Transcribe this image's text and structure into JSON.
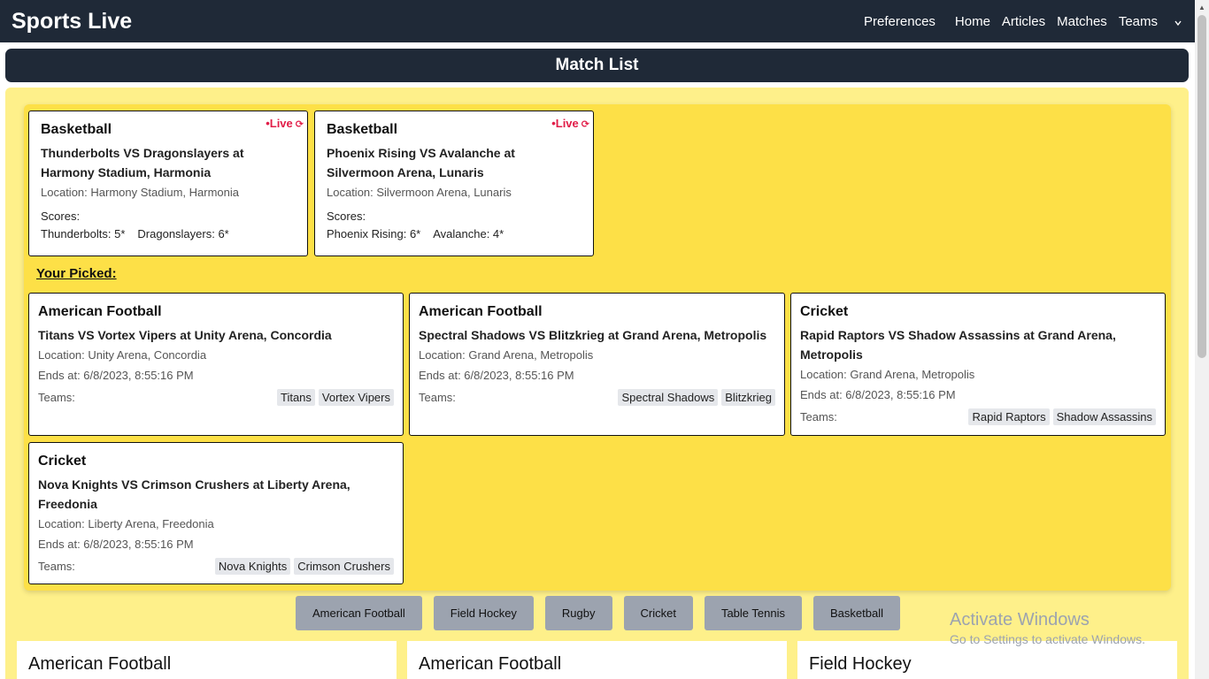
{
  "navbar": {
    "brand": "Sports Live",
    "preferences": "Preferences",
    "links": [
      "Home",
      "Articles",
      "Matches",
      "Teams"
    ],
    "dropdown_icon": "chevron-down-icon"
  },
  "page_title": "Match List",
  "live_matches": [
    {
      "sport": "Basketball",
      "title": "Thunderbolts VS Dragonslayers at Harmony Stadium, Harmonia",
      "location": "Location: Harmony Stadium, Harmonia",
      "live_label": "•Live",
      "scores_label": "Scores:",
      "score1": "Thunderbolts: 5*",
      "score2": "Dragonslayers: 6*"
    },
    {
      "sport": "Basketball",
      "title": "Phoenix Rising VS Avalanche at Silvermoon Arena, Lunaris",
      "location": "Location: Silvermoon Arena, Lunaris",
      "live_label": "•Live",
      "scores_label": "Scores:",
      "score1": "Phoenix Rising: 6*",
      "score2": "Avalanche: 4*"
    }
  ],
  "picked_label": "Your Picked:",
  "picked_matches": [
    {
      "sport": "American Football",
      "title": "Titans VS Vortex Vipers at Unity Arena, Concordia",
      "location": "Location: Unity Arena, Concordia",
      "ends": "Ends at: 6/8/2023, 8:55:16 PM",
      "teams_label": "Teams:",
      "team1": "Titans",
      "team2": "Vortex Vipers"
    },
    {
      "sport": "American Football",
      "title": "Spectral Shadows VS Blitzkrieg at Grand Arena, Metropolis",
      "location": "Location: Grand Arena, Metropolis",
      "ends": "Ends at: 6/8/2023, 8:55:16 PM",
      "teams_label": "Teams:",
      "team1": "Spectral Shadows",
      "team2": "Blitzkrieg"
    },
    {
      "sport": "Cricket",
      "title": "Rapid Raptors VS Shadow Assassins at Grand Arena, Metropolis",
      "location": "Location: Grand Arena, Metropolis",
      "ends": "Ends at: 6/8/2023, 8:55:16 PM",
      "teams_label": "Teams:",
      "team1": "Rapid Raptors",
      "team2": "Shadow Assassins"
    },
    {
      "sport": "Cricket",
      "title": "Nova Knights VS Crimson Crushers at Liberty Arena, Freedonia",
      "location": "Location: Liberty Arena, Freedonia",
      "ends": "Ends at: 6/8/2023, 8:55:16 PM",
      "teams_label": "Teams:",
      "team1": "Nova Knights",
      "team2": "Crimson Crushers"
    }
  ],
  "filters": [
    "American Football",
    "Field Hockey",
    "Rugby",
    "Cricket",
    "Table Tennis",
    "Basketball"
  ],
  "bottom_cards": [
    "American Football",
    "American Football",
    "Field Hockey"
  ],
  "watermark": {
    "line1": "Activate Windows",
    "line2": "Go to Settings to activate Windows."
  },
  "colors": {
    "navbar": "#1f2937",
    "outer_yellow": "#fef08a",
    "inner_yellow": "#fde047",
    "live": "#e11d48",
    "filter_button": "#9ca3af"
  }
}
